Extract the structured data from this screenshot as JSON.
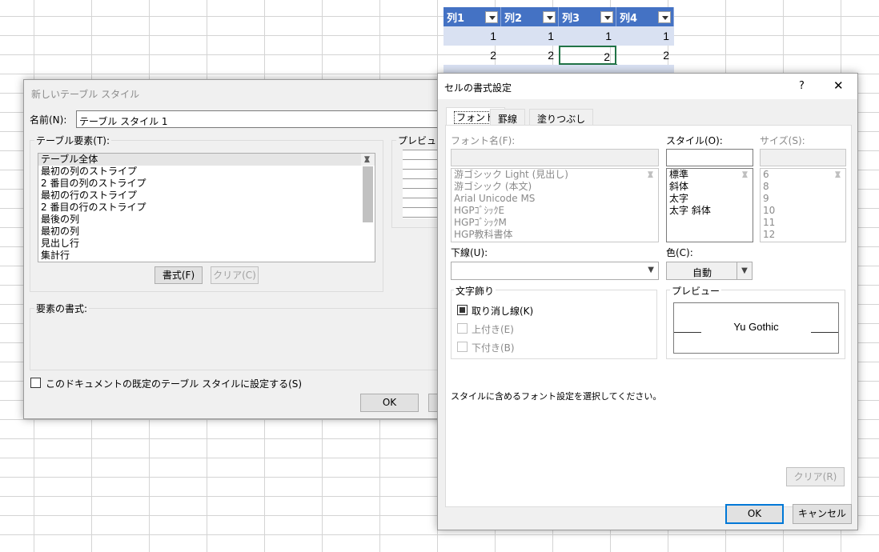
{
  "excel": {
    "headers": [
      "列1",
      "列2",
      "列3",
      "列4"
    ],
    "row1": [
      "1",
      "1",
      "1",
      "1"
    ],
    "row2": [
      "2",
      "2",
      "2",
      "2"
    ]
  },
  "new_style_dialog": {
    "title": "新しいテーブル スタイル",
    "name_label": "名前(N):",
    "name_value": "テーブル スタイル 1",
    "elements_label": "テーブル要素(T):",
    "elements": [
      "テーブル全体",
      "最初の列のストライプ",
      "2 番目の列のストライプ",
      "最初の行のストライプ",
      "2 番目の行のストライプ",
      "最後の列",
      "最初の列",
      "見出し行",
      "集計行"
    ],
    "preview_label": "プレビュー",
    "format_button": "書式(F)",
    "clear_button": "クリア(C)",
    "element_format_label": "要素の書式:",
    "default_checkbox": "このドキュメントの既定のテーブル スタイルに設定する(S)",
    "ok_button": "OK"
  },
  "format_dialog": {
    "title": "セルの書式設定",
    "help": "?",
    "close": "✕",
    "tabs": [
      "フォント",
      "罫線",
      "塗りつぶし"
    ],
    "font_label": "フォント名(F):",
    "fonts": [
      "游ゴシック Light (見出し)",
      "游ゴシック (本文)",
      "Arial Unicode MS",
      "HGPｺﾞｼｯｸE",
      "HGPｺﾞｼｯｸM",
      "HGP教科書体"
    ],
    "style_label": "スタイル(O):",
    "styles": [
      "標準",
      "斜体",
      "太字",
      "太字 斜体"
    ],
    "size_label": "サイズ(S):",
    "sizes": [
      "6",
      "8",
      "9",
      "10",
      "11",
      "12"
    ],
    "underline_label": "下線(U):",
    "color_label": "色(C):",
    "color_value": "自動",
    "effects_label": "文字飾り",
    "strikethrough": "取り消し線(K)",
    "superscript": "上付き(E)",
    "subscript": "下付き(B)",
    "preview_label": "プレビュー",
    "preview_text": "Yu Gothic",
    "hint": "スタイルに含めるフォント設定を選択してください。",
    "clear_button": "クリア(R)",
    "ok_button": "OK",
    "cancel_button": "キャンセル"
  },
  "colors": {
    "table_header": "#4472c4",
    "band": "#d9e1f2",
    "focus": "#0078d7"
  }
}
